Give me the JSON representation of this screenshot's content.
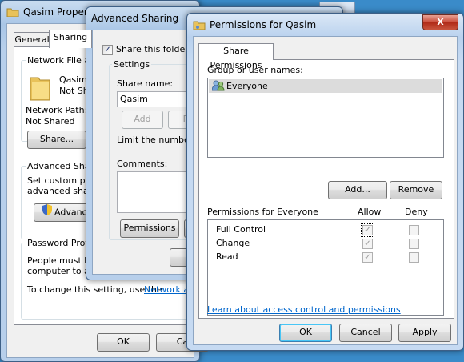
{
  "desktop": {
    "background": "#3a8bc9"
  },
  "props_window": {
    "title": "Qasim Properties",
    "close_label": "X",
    "tabs": [
      "General",
      "Sharing"
    ],
    "active_tab": "Sharing",
    "network_group": {
      "title": "Network File and",
      "folder_name": "Qasim",
      "folder_status": "Not Sh",
      "path_label": "Network Path:",
      "path_value": "Not Shared",
      "share_button": "Share..."
    },
    "advanced_group": {
      "title": "Advanced Sharin",
      "desc_line1": "Set custom pern",
      "desc_line2": "advanced sharin",
      "button": "Advance"
    },
    "password_group": {
      "title": "Password Protec",
      "desc_line1": "People must hav",
      "desc_line2": "computer to acc",
      "change_text": "To change this setting, use the",
      "change_link": "Network and"
    },
    "ok_button": "OK",
    "cancel_button": "Ca"
  },
  "adv_window": {
    "title": "Advanced Sharing",
    "share_checkbox_label": "Share this folder",
    "share_checked": true,
    "settings_title": "Settings",
    "share_name_label": "Share name:",
    "share_name_value": "Qasim",
    "add_button": "Add",
    "remove_button": "Rem",
    "limit_label": "Limit the number of s",
    "comments_label": "Comments:",
    "permissions_button": "Permissions",
    "ok_button": "O"
  },
  "perm_window": {
    "title": "Permissions for Qasim",
    "close_label": "X",
    "tab": "Share Permissions",
    "group_label": "Group or user names:",
    "users": [
      "Everyone"
    ],
    "add_button": "Add...",
    "remove_button": "Remove",
    "perms_for_label": "Permissions for Everyone",
    "allow_header": "Allow",
    "deny_header": "Deny",
    "permissions": [
      {
        "name": "Full Control",
        "allow": true,
        "deny": false
      },
      {
        "name": "Change",
        "allow": true,
        "deny": false
      },
      {
        "name": "Read",
        "allow": true,
        "deny": false
      }
    ],
    "learn_link": "Learn about access control and permissions",
    "ok_button": "OK",
    "cancel_button": "Cancel",
    "apply_button": "Apply"
  }
}
